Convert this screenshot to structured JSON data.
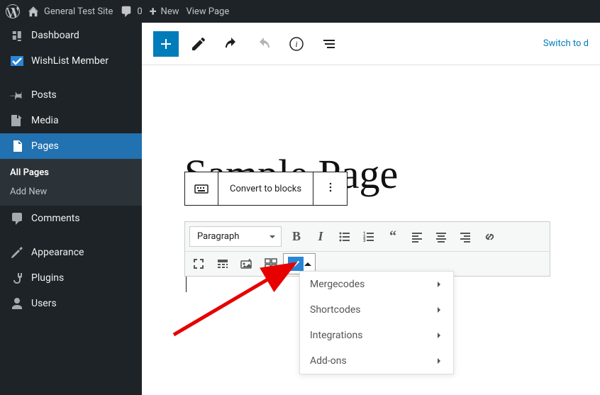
{
  "topbar": {
    "site_name": "General Test Site",
    "comments_count": "0",
    "new_label": "New",
    "view_label": "View Page"
  },
  "sidebar": {
    "dashboard": "Dashboard",
    "wishlist": "WishList Member",
    "posts": "Posts",
    "media": "Media",
    "pages": "Pages",
    "pages_sub": {
      "all": "All Pages",
      "add": "Add New"
    },
    "comments": "Comments",
    "appearance": "Appearance",
    "plugins": "Plugins",
    "users": "Users"
  },
  "editor": {
    "switch_link": "Switch to d",
    "page_title": "Sample Page",
    "convert_btn": "Convert to blocks",
    "format_select": "Paragraph",
    "dropdown": {
      "mergecodes": "Mergecodes",
      "shortcodes": "Shortcodes",
      "integrations": "Integrations",
      "addons": "Add-ons"
    }
  },
  "colors": {
    "primary": "#007cba",
    "sidebar_active": "#2271b1"
  }
}
